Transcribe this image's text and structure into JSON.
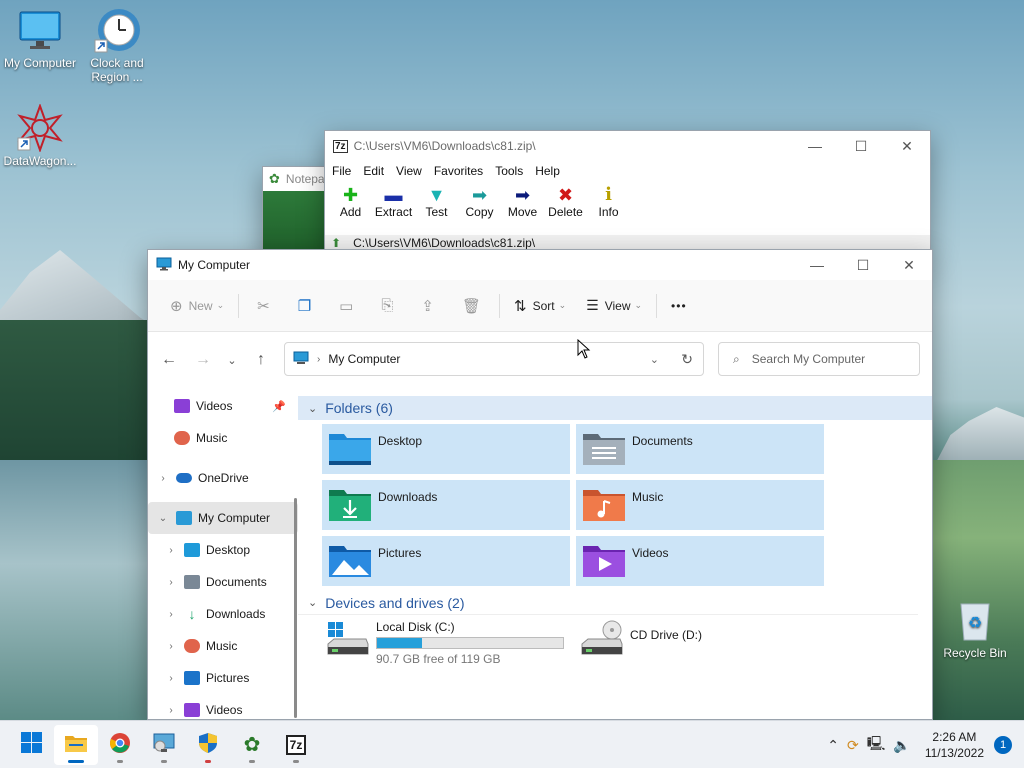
{
  "desktop": {
    "icons": [
      {
        "label": "My Computer"
      },
      {
        "label": "Clock and Region ..."
      },
      {
        "label": "DataWagon..."
      },
      {
        "label": "Recycle Bin"
      }
    ]
  },
  "notepad": {
    "title": "Notepa"
  },
  "sevenzip": {
    "title": "C:\\Users\\VM6\\Downloads\\c81.zip\\",
    "menu": [
      "File",
      "Edit",
      "View",
      "Favorites",
      "Tools",
      "Help"
    ],
    "tools": [
      {
        "label": "Add",
        "icon": "plus-icon",
        "color": "#19b319"
      },
      {
        "label": "Extract",
        "icon": "minus-icon",
        "color": "#1a2fa8"
      },
      {
        "label": "Test",
        "icon": "check-icon",
        "color": "#1ab3b3"
      },
      {
        "label": "Copy",
        "icon": "arrow-icon",
        "color": "#1a9a9a"
      },
      {
        "label": "Move",
        "icon": "arrow-icon",
        "color": "#0a1a7a"
      },
      {
        "label": "Delete",
        "icon": "x-icon",
        "color": "#d01818"
      },
      {
        "label": "Info",
        "icon": "info-icon",
        "color": "#b8a000"
      }
    ],
    "address": "C:\\Users\\VM6\\Downloads\\c81.zip\\"
  },
  "explorer": {
    "title": "My Computer",
    "commands": {
      "new": "New",
      "sort": "Sort",
      "view": "View",
      "more": "•••"
    },
    "address": "My Computer",
    "search_placeholder": "Search My Computer",
    "sidebar": [
      {
        "label": "Videos",
        "level": 1,
        "expand": "",
        "icon_color": "#8a3fd6",
        "pinned": true
      },
      {
        "label": "Music",
        "level": 1,
        "expand": "",
        "icon_color": "#e0644c"
      },
      {
        "label": "OneDrive",
        "level": 0,
        "expand": "›",
        "icon_color": "#1f6fc5"
      },
      {
        "label": "My Computer",
        "level": 0,
        "expand": "⌄",
        "icon_color": "#2a9ad6",
        "selected": true
      },
      {
        "label": "Desktop",
        "level": 1,
        "expand": "›",
        "icon_color": "#1e9ad9"
      },
      {
        "label": "Documents",
        "level": 1,
        "expand": "›",
        "icon_color": "#7a8896"
      },
      {
        "label": "Downloads",
        "level": 1,
        "expand": "›",
        "icon_color": "#1aa36a"
      },
      {
        "label": "Music",
        "level": 1,
        "expand": "›",
        "icon_color": "#e0644c"
      },
      {
        "label": "Pictures",
        "level": 1,
        "expand": "›",
        "icon_color": "#1b73c9"
      },
      {
        "label": "Videos",
        "level": 1,
        "expand": "›",
        "icon_color": "#8a3fd6"
      }
    ],
    "folders_header": "Folders (6)",
    "folders": [
      {
        "label": "Desktop",
        "color": "#1e88d6"
      },
      {
        "label": "Documents",
        "color": "#7e8c99"
      },
      {
        "label": "Downloads",
        "color": "#17a06a"
      },
      {
        "label": "Music",
        "color": "#e8663e"
      },
      {
        "label": "Pictures",
        "color": "#1b73c9"
      },
      {
        "label": "Videos",
        "color": "#8a3fd6"
      }
    ],
    "drives_header": "Devices and drives (2)",
    "drives": [
      {
        "label": "Local Disk (C:)",
        "free": "90.7 GB free of 119 GB",
        "used_fraction": 0.24
      },
      {
        "label": "CD Drive (D:)"
      }
    ]
  },
  "taskbar": {
    "apps": [
      "start",
      "file-explorer",
      "chrome",
      "control-panel",
      "security",
      "datawagon",
      "7zip"
    ],
    "time": "2:26 AM",
    "date": "11/13/2022",
    "notifications": "1"
  }
}
